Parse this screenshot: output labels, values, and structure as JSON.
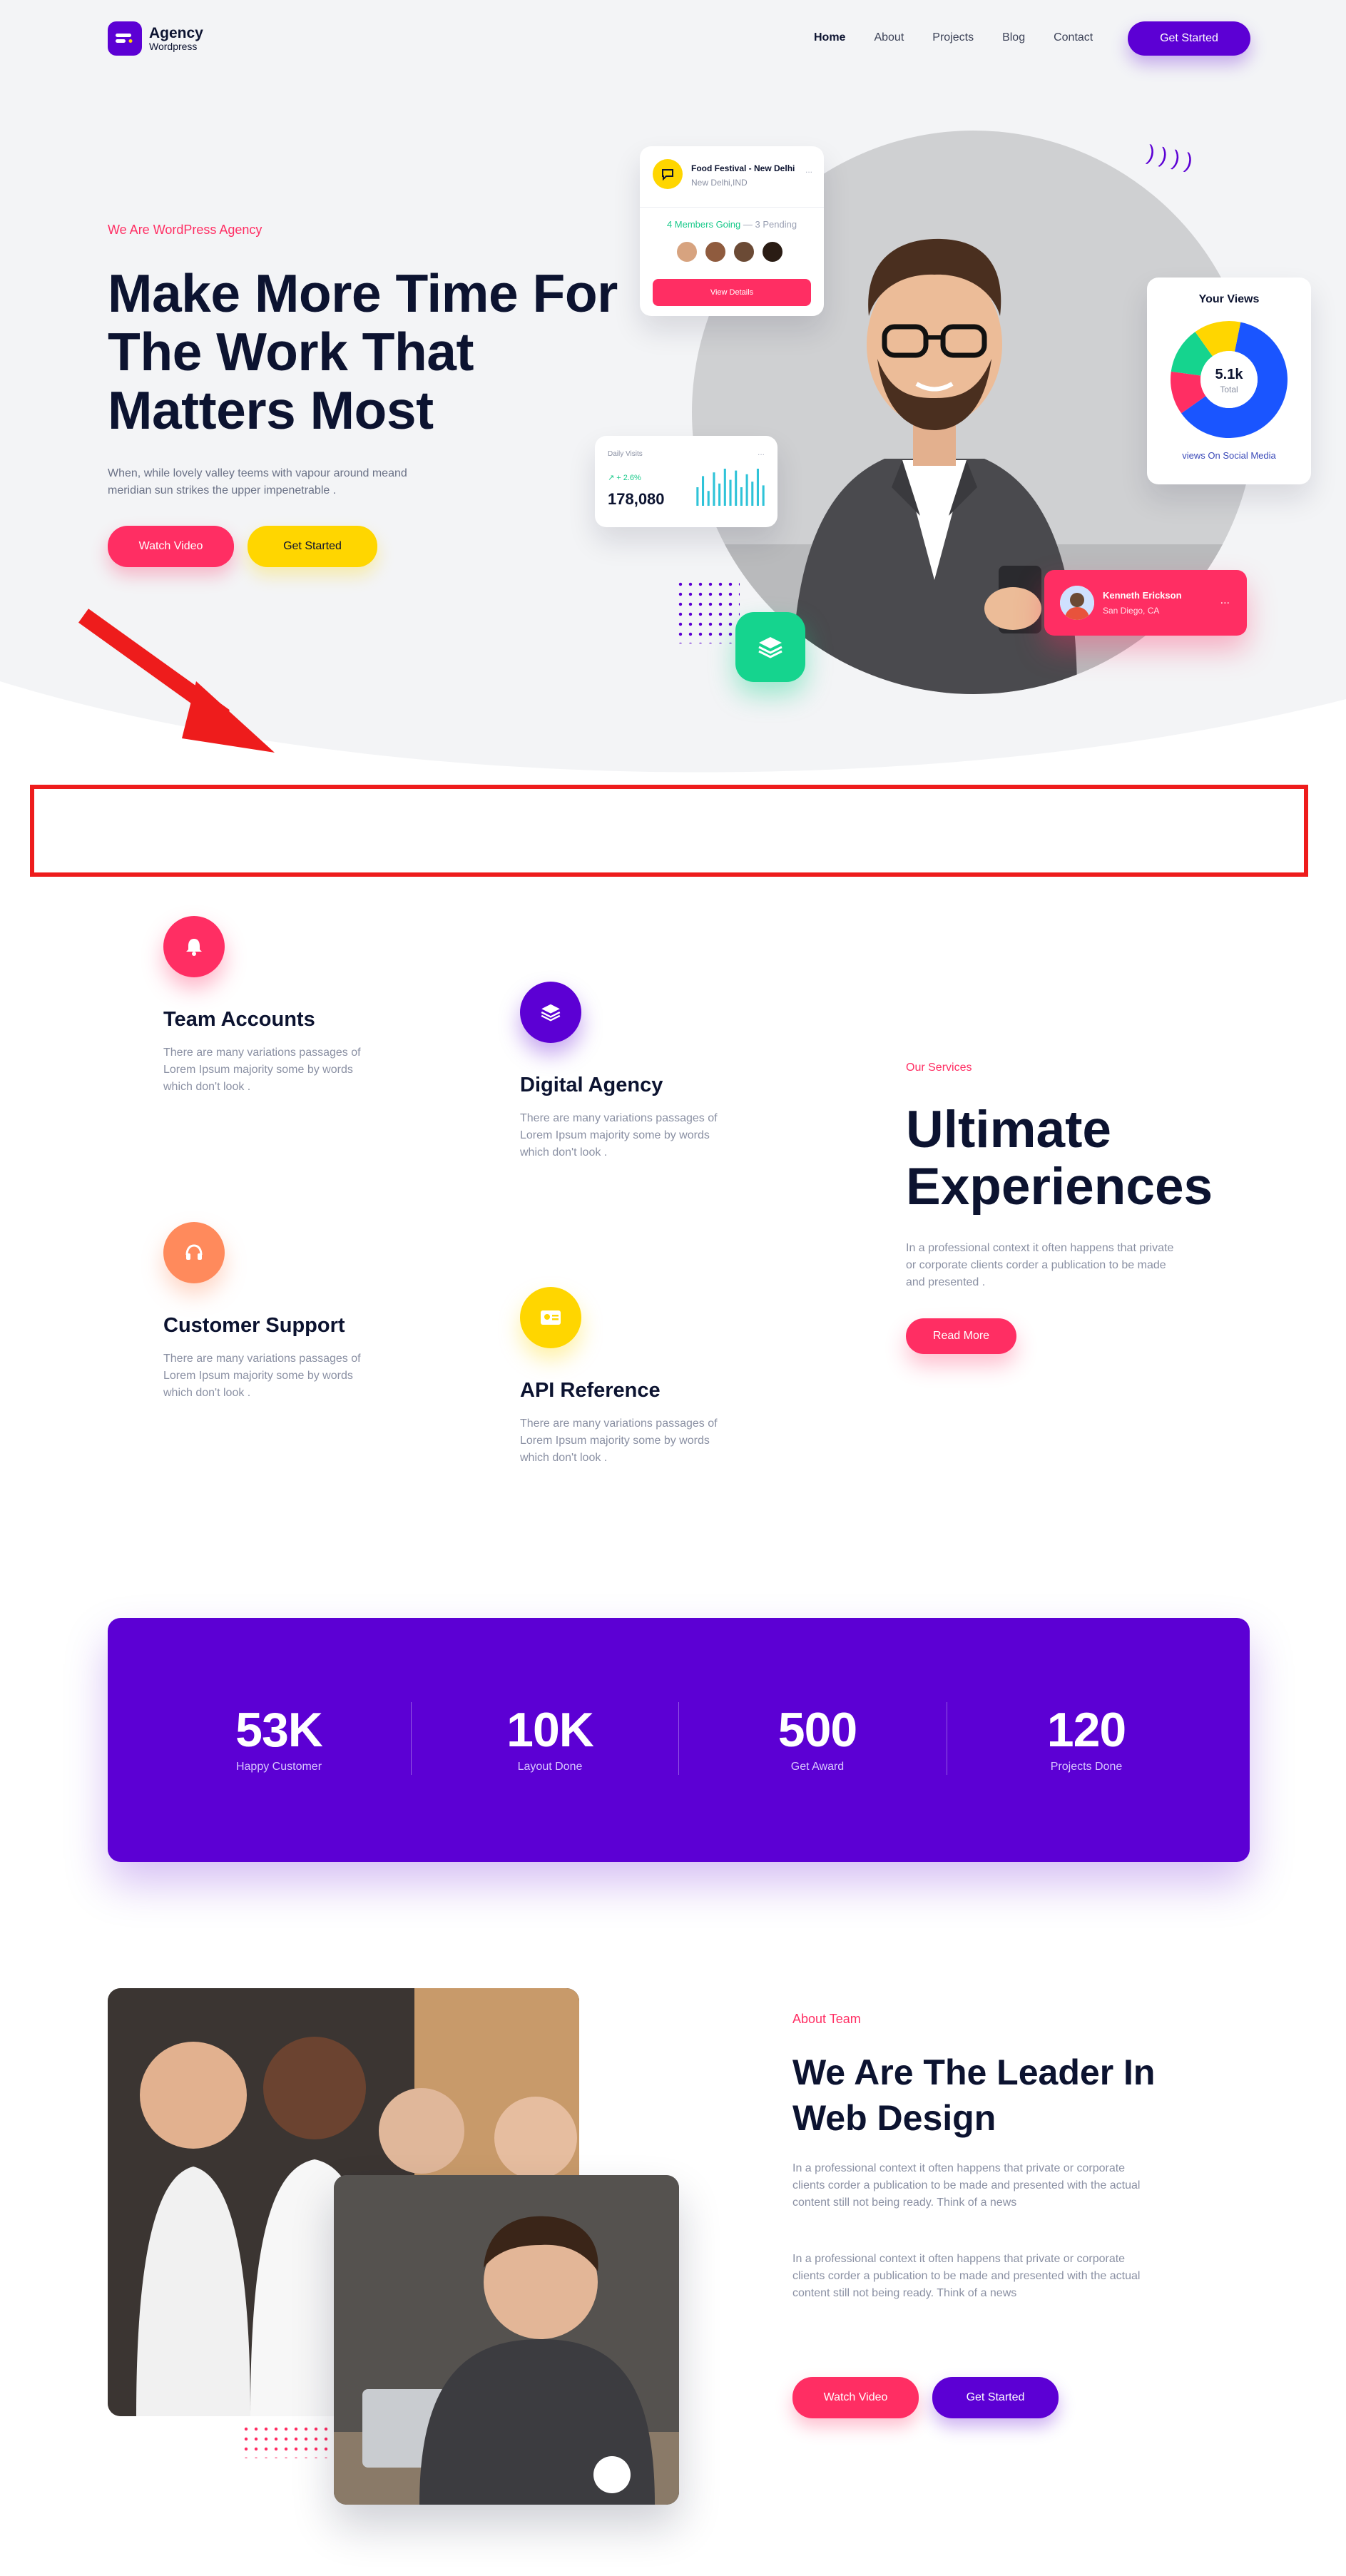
{
  "brand": {
    "name": "Agency",
    "tagline": "Wordpress"
  },
  "nav": {
    "items": [
      "Home",
      "About",
      "Projects",
      "Blog",
      "Contact"
    ],
    "active": "Home",
    "cta": "Get Started"
  },
  "hero": {
    "eyebrow": "We Are WordPress Agency",
    "title": "Make More Time For The Work That Matters Most",
    "subtitle": "When, while lovely valley teems with vapour around meand meridian sun strikes the upper impenetrable .",
    "watch_label": "Watch Video",
    "start_label": "Get Started"
  },
  "event_card": {
    "title": "Food Festival - New Delhi",
    "location": "New Delhi,IND",
    "going": "4 Members Going",
    "pending": "— 3 Pending",
    "button": "View Details",
    "menu": "..."
  },
  "visits_card": {
    "label": "Daily Visits",
    "delta": "↗ + 2.6%",
    "value": "178,080",
    "menu": "...",
    "bars": [
      0.5,
      0.8,
      0.4,
      0.9,
      0.6,
      1.0,
      0.7,
      0.95,
      0.5,
      0.85,
      0.65,
      1.0,
      0.55
    ]
  },
  "views_card": {
    "title": "Your Views",
    "value": "5.1k",
    "unit": "Total",
    "caption": "views On Social Media",
    "segments": [
      {
        "color": "#1a55ff",
        "share": 0.62
      },
      {
        "color": "#ff2e63",
        "share": 0.12
      },
      {
        "color": "#15d48e",
        "share": 0.13
      },
      {
        "color": "#ffd600",
        "share": 0.13
      }
    ]
  },
  "profile_card": {
    "name": "Kenneth Erickson",
    "location": "San Diego, CA",
    "menu": "..."
  },
  "services": {
    "items": [
      {
        "title": "Team Accounts",
        "desc": "There are many variations passages of Lorem Ipsum majority some by words which don't look .",
        "icon": "bell-icon"
      },
      {
        "title": "Digital Agency",
        "desc": "There are many variations passages of Lorem Ipsum majority some by words which don't look .",
        "icon": "layers-icon"
      },
      {
        "title": "Customer Support",
        "desc": "There are many variations passages of Lorem Ipsum majority some by words which don't look .",
        "icon": "headphones-icon"
      },
      {
        "title": "API Reference",
        "desc": "There are many variations passages of Lorem Ipsum majority some by words which don't look .",
        "icon": "id-card-icon"
      }
    ],
    "eyebrow": "Our Services",
    "heading_line1": "Ultimate",
    "heading_line2": "Experiences",
    "text": "In a professional context it often happens that private or corporate clients corder a publication to be made and presented .",
    "button": "Read More"
  },
  "stats": [
    {
      "value": "53K",
      "label": "Happy Customer"
    },
    {
      "value": "10K",
      "label": "Layout Done"
    },
    {
      "value": "500",
      "label": "Get Award"
    },
    {
      "value": "120",
      "label": "Projects Done"
    }
  ],
  "about": {
    "eyebrow": "About Team",
    "heading": "We Are The Leader In Web Design",
    "p1": "In a professional context it often happens that private or corporate clients corder a publication to be made and presented with the actual content still not being ready. Think of a news",
    "p2": "In a professional context it often happens that private or corporate clients corder a publication to be made and presented with the actual content still not being ready. Think of a news",
    "watch_label": "Watch Video",
    "start_label": "Get Started"
  },
  "colors": {
    "purple": "#5c00d4",
    "pink": "#ff2e63",
    "yellow": "#ffd600",
    "green": "#15d48e",
    "orange": "#ff8a5c",
    "annotation_red": "#ee1c1c"
  }
}
